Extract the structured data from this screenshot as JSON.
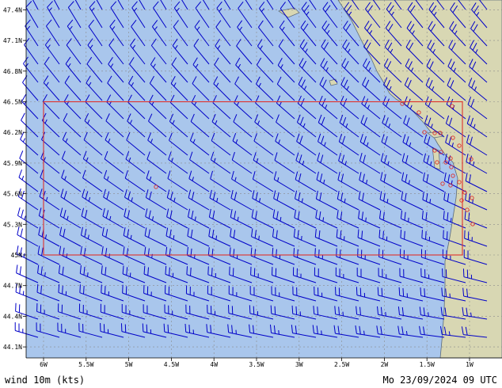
{
  "map": {
    "variable_label": "wind 10m (kts)",
    "timestamp": "Mo 23/09/2024 09 UTC",
    "lat_labels": [
      "47.4N",
      "47.1N",
      "46.8N",
      "46.5N",
      "46.2N",
      "45.9N",
      "45.6N",
      "45.3N",
      "45N",
      "44.7N",
      "44.4N",
      "44.1N"
    ],
    "lon_labels": [
      "6W",
      "5.5W",
      "5W",
      "4.5W",
      "4W",
      "3.5W",
      "3W",
      "2.5W",
      "2W",
      "1.5W",
      "1W"
    ],
    "colors": {
      "sea": "#a9c6ec",
      "land": "#d8d7b3",
      "coast": "#5a6a7a",
      "grid": "#8a8a8a",
      "barbs": "#0000c8",
      "domain_box": "#e0302a",
      "stations": "#e0302a"
    },
    "domain_box": {
      "lat_range": [
        "45N",
        "46.5N"
      ],
      "lon_start": "6W"
    },
    "icons": {
      "wind_barb": "wind-barb-icon",
      "station": "station-marker-icon"
    }
  }
}
